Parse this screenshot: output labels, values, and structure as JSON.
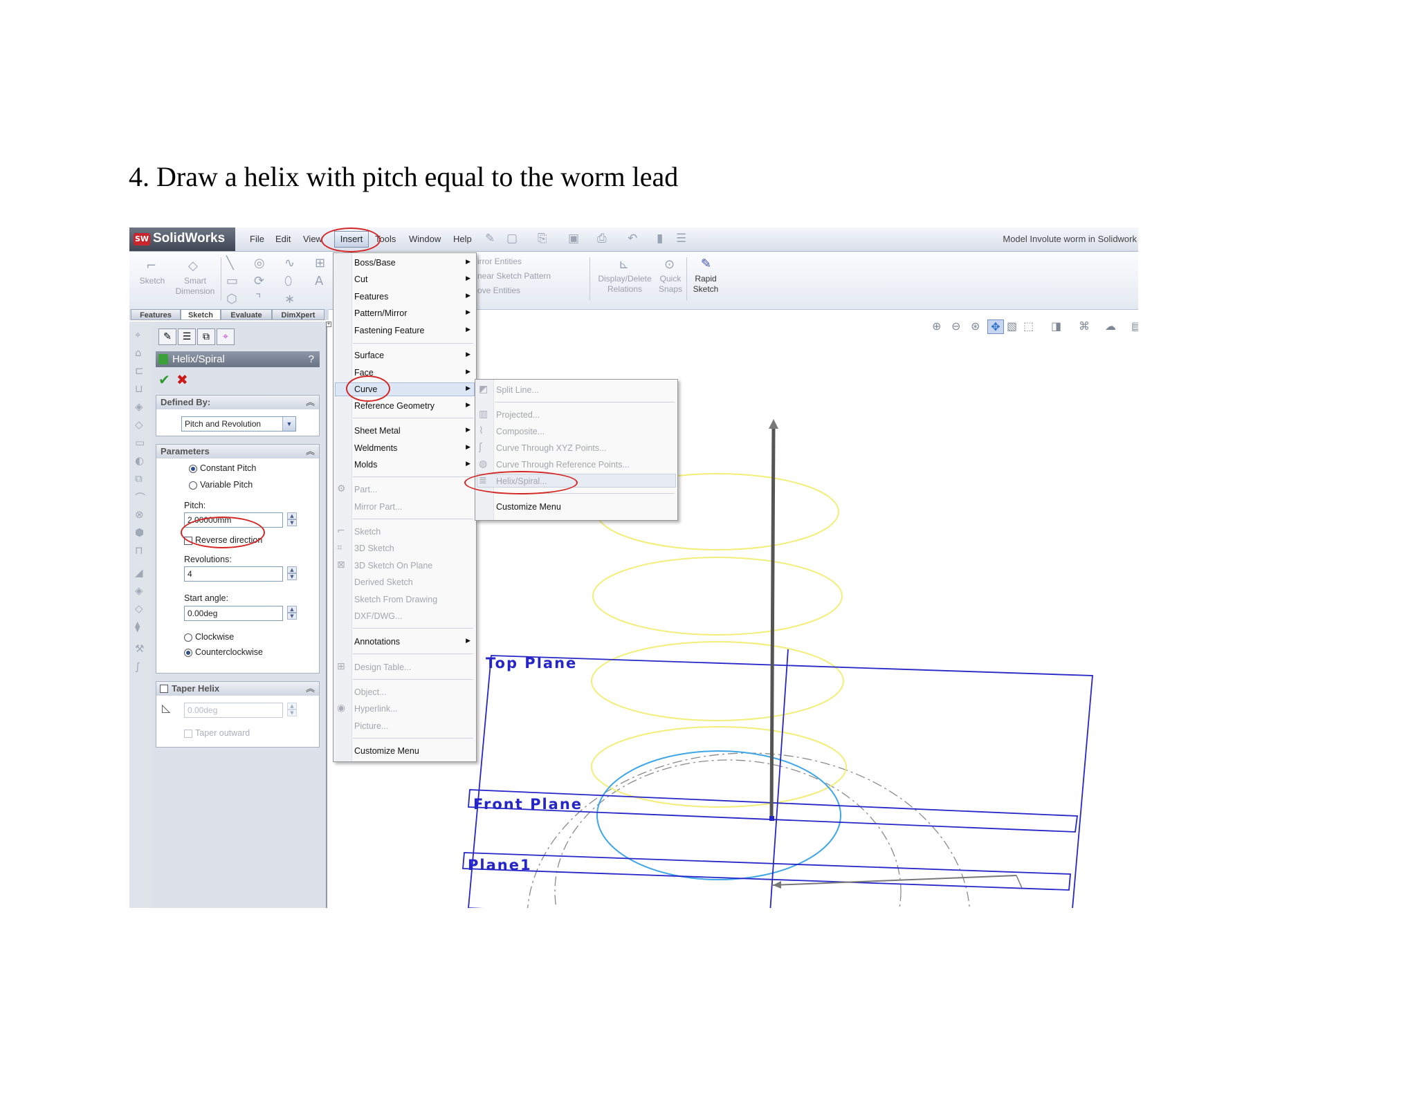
{
  "document": {
    "heading": "4. Draw a helix with pitch equal to the worm lead"
  },
  "app": {
    "logo": "SolidWorks",
    "window_title": "Model Involute worm in Solidwork"
  },
  "menubar": {
    "file": "File",
    "edit": "Edit",
    "view": "View",
    "insert": "Insert",
    "tools": "Tools",
    "window": "Window",
    "help": "Help"
  },
  "ribbon": {
    "sketch": "Sketch",
    "smart_dimension_1": "Smart",
    "smart_dimension_2": "Dimension",
    "mirror_entities": "irror Entities",
    "linear_sketch_pattern": "near Sketch Pattern",
    "move_entities": "ove Entities",
    "display_delete_1": "Display/Delete",
    "display_delete_2": "Relations",
    "quick_snaps_1": "Quick",
    "quick_snaps_2": "Snaps",
    "rapid_sketch_1": "Rapid",
    "rapid_sketch_2": "Sketch"
  },
  "tabs": {
    "features": "Features",
    "sketch": "Sketch",
    "evaluate": "Evaluate",
    "dimxpert": "DimXpert"
  },
  "property_manager": {
    "title": "Helix/Spiral",
    "help": "?",
    "defined_by": {
      "header": "Defined By:",
      "value": "Pitch and Revolution"
    },
    "parameters": {
      "header": "Parameters",
      "constant_pitch": "Constant Pitch",
      "variable_pitch": "Variable Pitch",
      "pitch_label": "Pitch:",
      "pitch_value": "2.00000mm",
      "reverse_direction": "Reverse direction",
      "revolutions_label": "Revolutions:",
      "revolutions_value": "4",
      "start_angle_label": "Start angle:",
      "start_angle_value": "0.00deg",
      "clockwise": "Clockwise",
      "counterclockwise": "Counterclockwise"
    },
    "taper_helix": {
      "header": "Taper Helix",
      "value": "0.00deg",
      "taper_outward": "Taper outward"
    }
  },
  "insert_menu": {
    "boss_base": "Boss/Base",
    "cut": "Cut",
    "features": "Features",
    "pattern_mirror": "Pattern/Mirror",
    "fastening_feature": "Fastening Feature",
    "surface": "Surface",
    "face": "Face",
    "curve": "Curve",
    "reference_geometry": "Reference Geometry",
    "sheet_metal": "Sheet Metal",
    "weldments": "Weldments",
    "molds": "Molds",
    "part": "Part...",
    "mirror_part": "Mirror Part...",
    "sketch": "Sketch",
    "sketch_3d": "3D Sketch",
    "sketch_3d_on_plane": "3D Sketch On Plane",
    "derived_sketch": "Derived Sketch",
    "sketch_from_drawing": "Sketch From Drawing",
    "dxf_dwg": "DXF/DWG...",
    "annotations": "Annotations",
    "design_table": "Design Table...",
    "object": "Object...",
    "hyperlink": "Hyperlink...",
    "picture": "Picture...",
    "customize_menu": "Customize Menu"
  },
  "curve_submenu": {
    "split_line": "Split Line...",
    "projected": "Projected...",
    "composite": "Composite...",
    "curve_xyz": "Curve Through XYZ Points...",
    "curve_ref": "Curve Through Reference Points...",
    "helix_spiral": "Helix/Spiral...",
    "customize_menu": "Customize Menu"
  },
  "viewport": {
    "top_plane": "Top Plane",
    "front_plane": "Front Plane",
    "plane1": "Plane1"
  },
  "colors": {
    "helix": "#f2ee78",
    "base_circle": "#3ea5e6",
    "plane": "#2626c8",
    "annotation": "#d42424"
  }
}
